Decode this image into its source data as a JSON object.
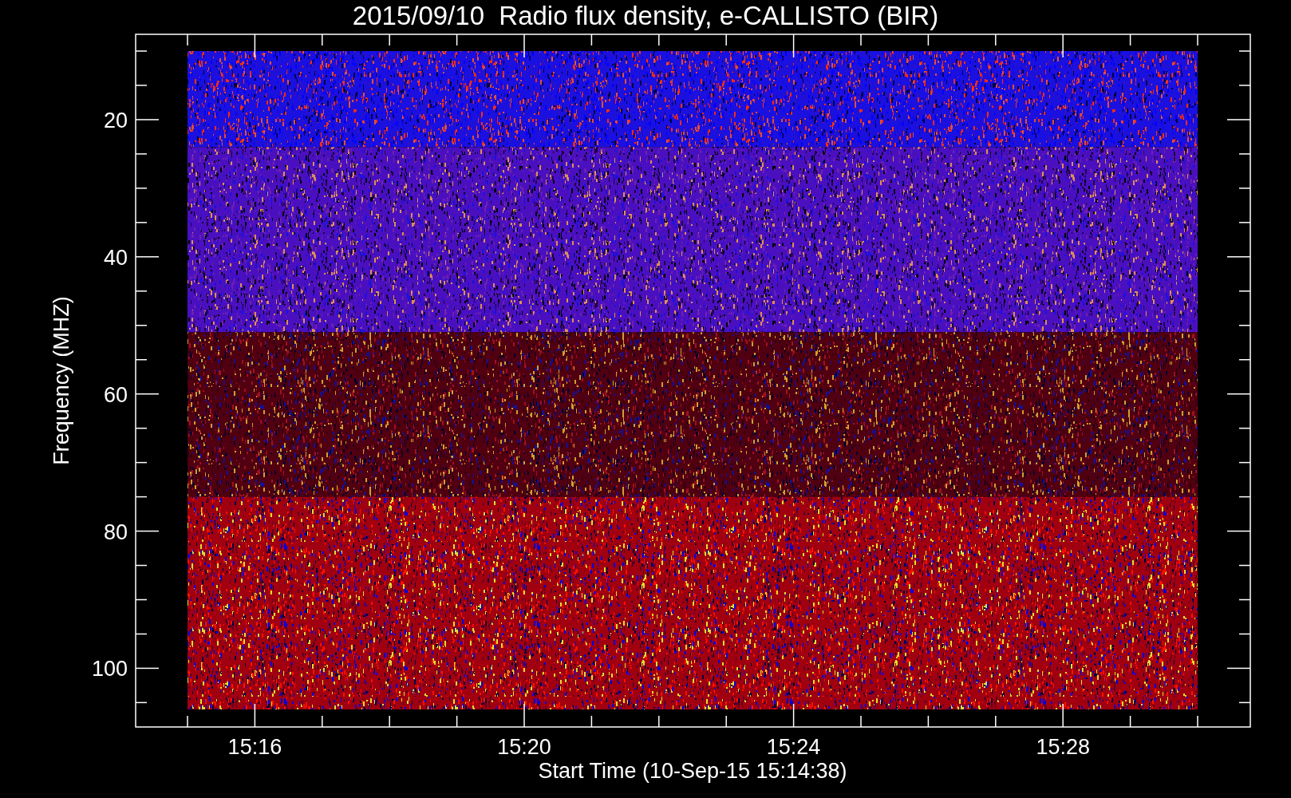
{
  "plot": {
    "title": "2015/09/10  Radio flux density, e-CALLISTO (BIR)",
    "ylabel": "Frequency (MHZ)",
    "xlabel": "Start Time (10-Sep-15 15:14:38)",
    "yticks": [
      "20",
      "40",
      "60",
      "80",
      "100"
    ],
    "xticks": [
      "15:16",
      "15:20",
      "15:24",
      "15:28"
    ]
  }
}
